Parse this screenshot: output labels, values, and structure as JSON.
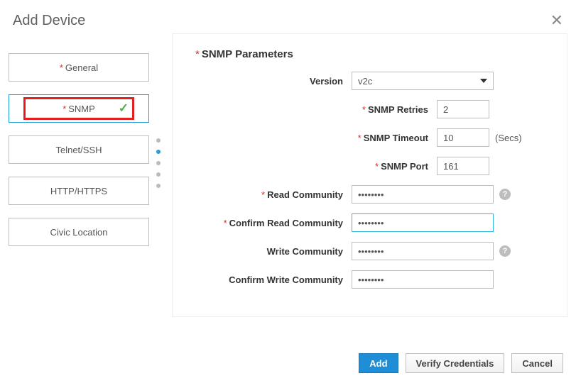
{
  "dialog": {
    "title": "Add Device"
  },
  "sidebar": {
    "items": [
      {
        "label": "General",
        "required": true,
        "active": false
      },
      {
        "label": "SNMP",
        "required": true,
        "active": true,
        "checked": true
      },
      {
        "label": "Telnet/SSH",
        "required": false,
        "active": false
      },
      {
        "label": "HTTP/HTTPS",
        "required": false,
        "active": false
      },
      {
        "label": "Civic Location",
        "required": false,
        "active": false
      }
    ]
  },
  "snmp": {
    "section_title": "SNMP Parameters",
    "labels": {
      "version": "Version",
      "retries": "SNMP Retries",
      "timeout": "SNMP Timeout",
      "timeout_suffix": "(Secs)",
      "port": "SNMP Port",
      "read_community": "Read Community",
      "confirm_read_community": "Confirm Read Community",
      "write_community": "Write Community",
      "confirm_write_community": "Confirm Write Community"
    },
    "values": {
      "version": "v2c",
      "retries": "2",
      "timeout": "10",
      "port": "161",
      "read_community": "••••••••",
      "confirm_read_community": "••••••••",
      "write_community": "••••••••",
      "confirm_write_community": "••••••••"
    }
  },
  "footer": {
    "add": "Add",
    "verify": "Verify Credentials",
    "cancel": "Cancel"
  },
  "icons": {
    "help": "?"
  }
}
